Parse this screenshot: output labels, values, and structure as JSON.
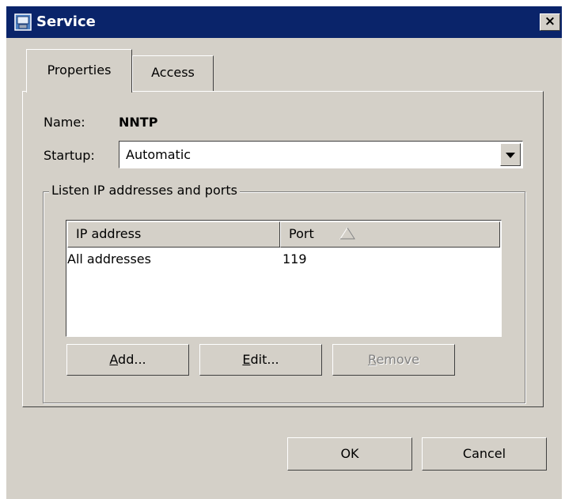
{
  "window": {
    "title": "Service",
    "close_glyph": "×"
  },
  "tabs": [
    {
      "label": "Properties",
      "active": true
    },
    {
      "label": "Access",
      "active": false
    }
  ],
  "fields": {
    "name_label": "Name:",
    "name_value": "NNTP",
    "startup_label": "Startup:",
    "startup_value": "Automatic"
  },
  "group": {
    "label": "Listen IP addresses and ports",
    "columns": [
      "IP address",
      "Port"
    ],
    "sort_column": "Port",
    "sort_direction": "ascending",
    "rows": [
      {
        "ip": "All addresses",
        "port": "119"
      }
    ]
  },
  "buttons": {
    "add_pre": "",
    "add_key": "A",
    "add_post": "dd...",
    "edit_pre": "",
    "edit_key": "E",
    "edit_post": "dit...",
    "remove_pre": "",
    "remove_key": "R",
    "remove_post": "emove",
    "ok": "OK",
    "cancel": "Cancel"
  },
  "colors": {
    "title_bar": "#0a246a",
    "face": "#d4d0c8"
  },
  "icons": {
    "app": "server-app-icon",
    "sort": "sort-ascending-triangle-icon",
    "dropdown": "dropdown-arrow-icon"
  }
}
